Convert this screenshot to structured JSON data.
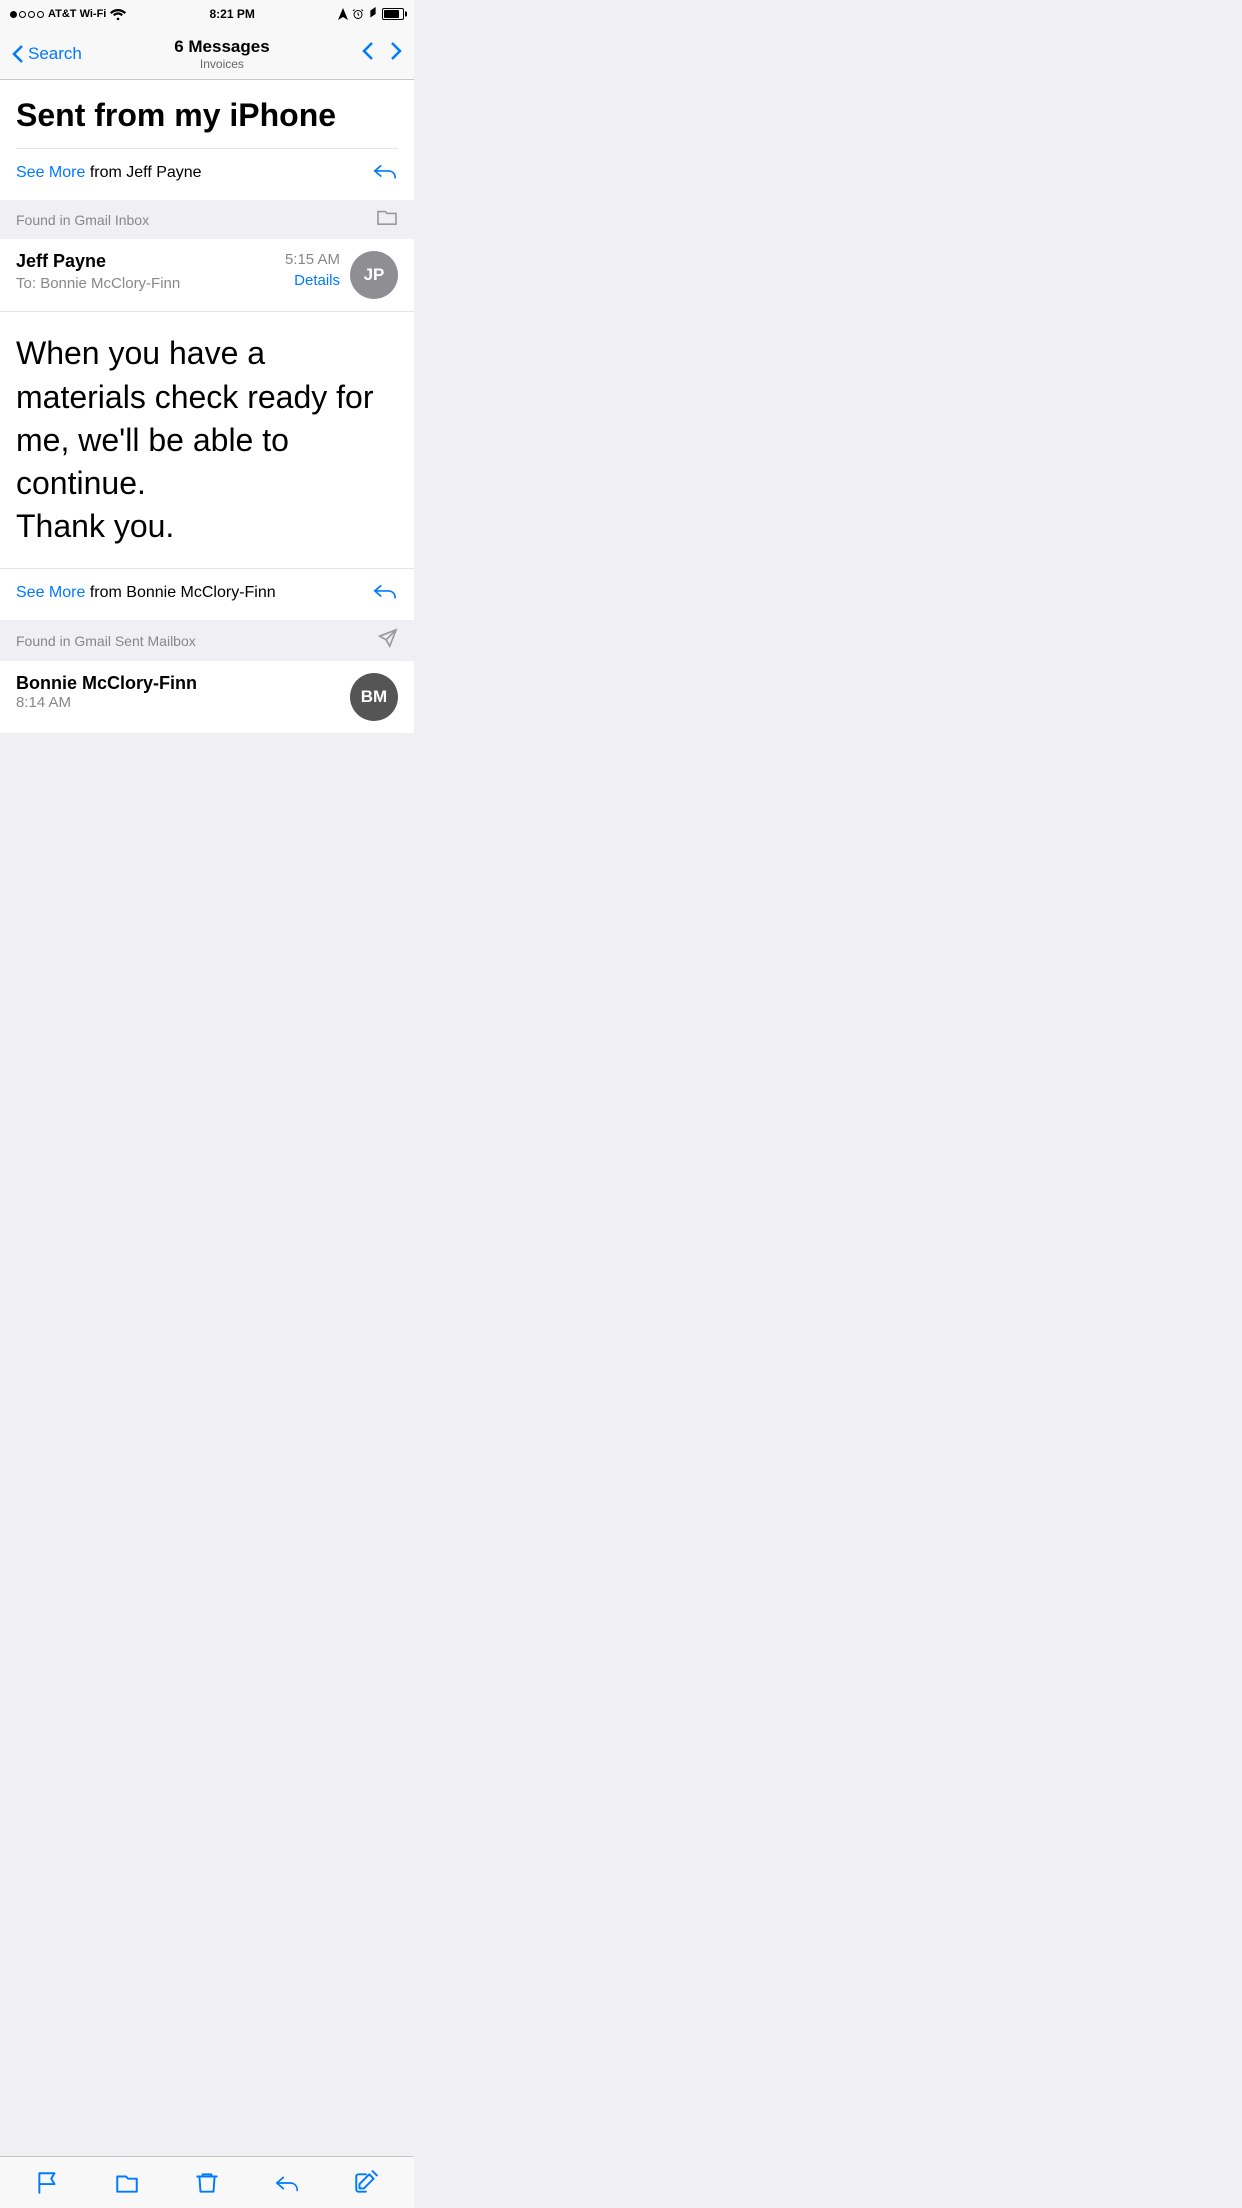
{
  "statusBar": {
    "carrier": "AT&T Wi-Fi",
    "time": "8:21 PM",
    "signals": [
      "filled",
      "empty",
      "empty",
      "empty"
    ]
  },
  "navBar": {
    "backLabel": "Search",
    "titleMain": "6 Messages",
    "titleSub": "Invoices",
    "prevArrow": "<",
    "nextArrow": ">"
  },
  "firstEmail": {
    "sentFromIphone": "Sent from my iPhone",
    "seeMoreLabel": "See More",
    "seeMoreFrom": " from Jeff Payne"
  },
  "sectionHeader1": {
    "text": "Found in Gmail Inbox",
    "iconLabel": "folder"
  },
  "emailCard": {
    "senderName": "Jeff Payne",
    "toLabel": "To: ",
    "toRecipient": "Bonnie McClory-Finn",
    "time": "5:15 AM",
    "detailsLabel": "Details",
    "avatarInitials": "JP",
    "bodyText": "When you have a materials check ready for me, we'll be able to continue.\nThank you.",
    "seeMoreLabel": "See More",
    "seeMoreFrom": " from Bonnie McClory-Finn"
  },
  "sectionHeader2": {
    "text": "Found in Gmail Sent Mailbox",
    "iconLabel": "send"
  },
  "emailPreview": {
    "senderName": "Bonnie McClory-Finn",
    "time": "8:14 AM",
    "avatarInitials": "BM"
  },
  "toolbar": {
    "flagLabel": "Flag",
    "folderLabel": "Folder",
    "trashLabel": "Trash",
    "replyLabel": "Reply",
    "composeLabel": "Compose"
  }
}
